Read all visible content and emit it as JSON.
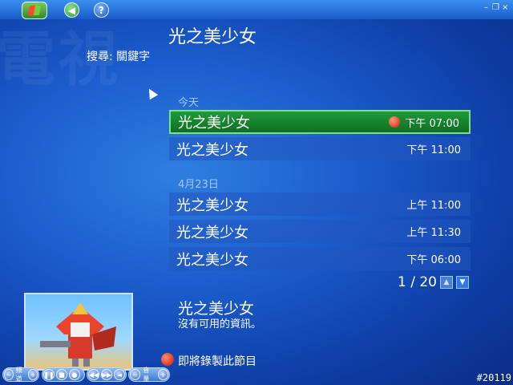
{
  "header": {
    "title": "光之美少女",
    "search_label": "搜尋: 關鍵字",
    "watermark": "電視"
  },
  "window_controls": {
    "minimize": "–",
    "restore": "❐",
    "close": "×"
  },
  "groups": [
    {
      "date": "今天",
      "items": [
        {
          "name": "光之美少女",
          "time": "下午 07:00",
          "selected": true,
          "recording": true
        },
        {
          "name": "光之美少女",
          "time": "下午 11:00"
        }
      ]
    },
    {
      "date": "4月23日",
      "items": [
        {
          "name": "光之美少女",
          "time": "上午 11:00"
        },
        {
          "name": "光之美少女",
          "time": "上午 11:30"
        },
        {
          "name": "光之美少女",
          "time": "下午 06:00"
        }
      ]
    }
  ],
  "pager": {
    "text": "1 / 20"
  },
  "details": {
    "title": "光之美少女",
    "description": "沒有可用的資訊。",
    "record_label": "即將錄製此節目"
  },
  "controls": {
    "channel_label": "頻道",
    "volume_label": "音量"
  },
  "counter": "#20119",
  "colors": {
    "selected_green": "#1f9a3a",
    "record_red": "#d21a0a",
    "background_blue": "#1c5fcf"
  }
}
